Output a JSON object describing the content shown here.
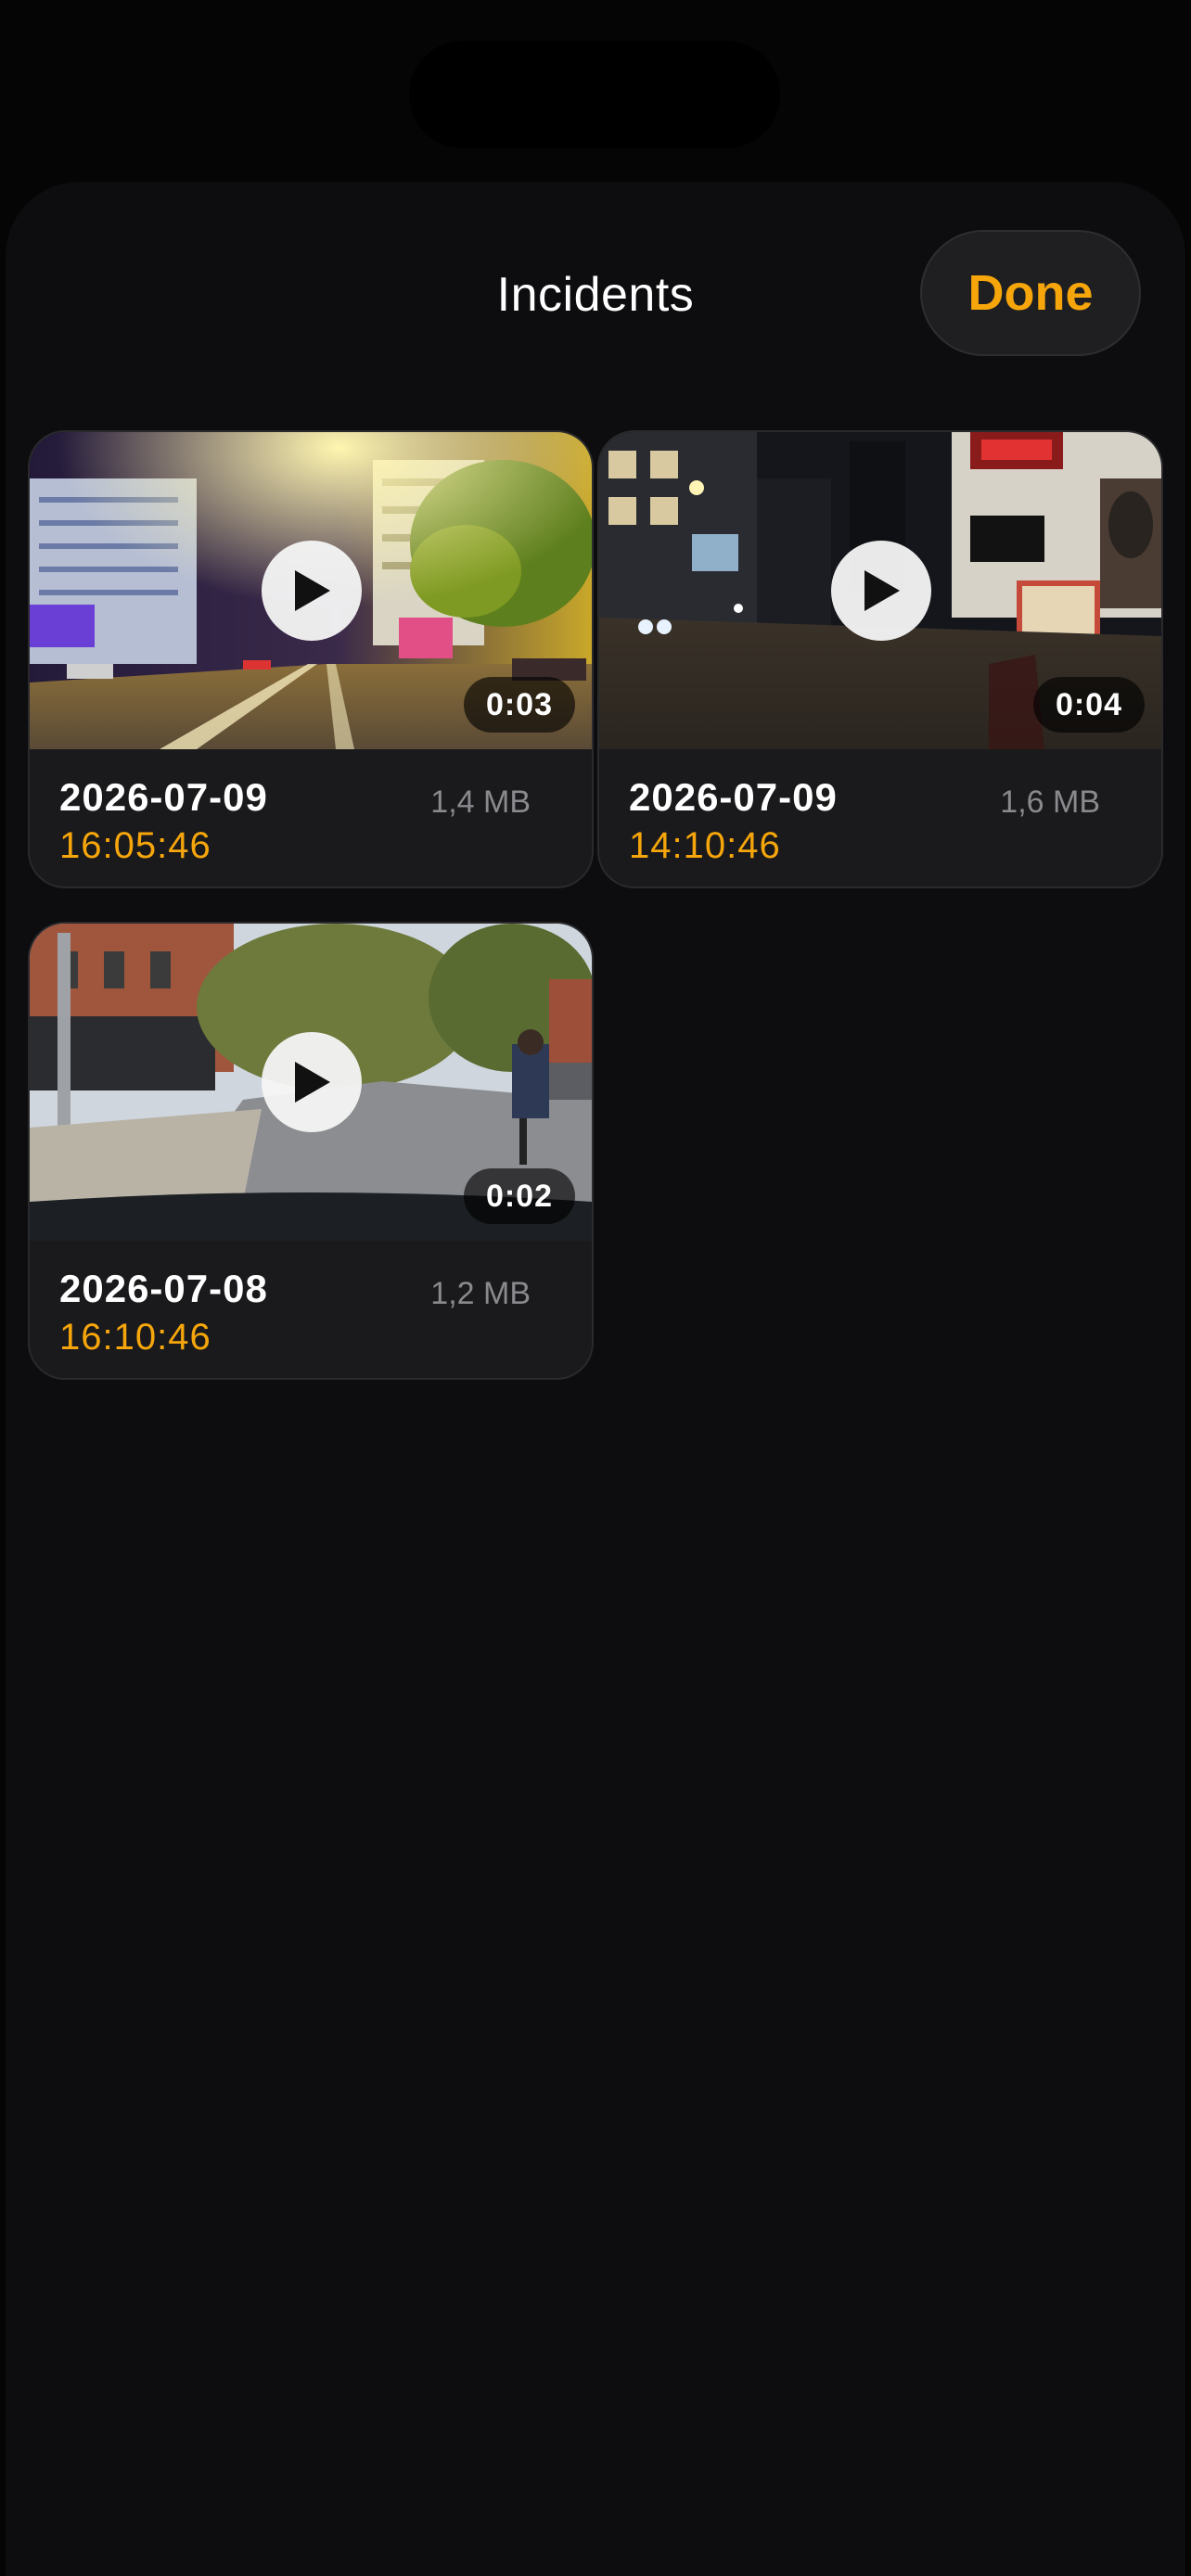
{
  "header": {
    "title": "Incidents",
    "done_label": "Done"
  },
  "colors": {
    "accent": "#f6a60b",
    "background": "#0d0d0f",
    "card": "#1a1a1c",
    "secondary_text": "#8a8a8e"
  },
  "incidents": [
    {
      "date": "2026-07-09",
      "time": "16:05:46",
      "size": "1,4 MB",
      "duration": "0:03",
      "thumbnail_scene": "night-street-golden-lights"
    },
    {
      "date": "2026-07-09",
      "time": "14:10:46",
      "size": "1,6 MB",
      "duration": "0:04",
      "thumbnail_scene": "night-city-street-no-parking-sign"
    },
    {
      "date": "2026-07-08",
      "time": "16:10:46",
      "size": "1,2 MB",
      "duration": "0:02",
      "thumbnail_scene": "day-street-cyclist"
    }
  ],
  "icons": {
    "play": "play-icon"
  }
}
